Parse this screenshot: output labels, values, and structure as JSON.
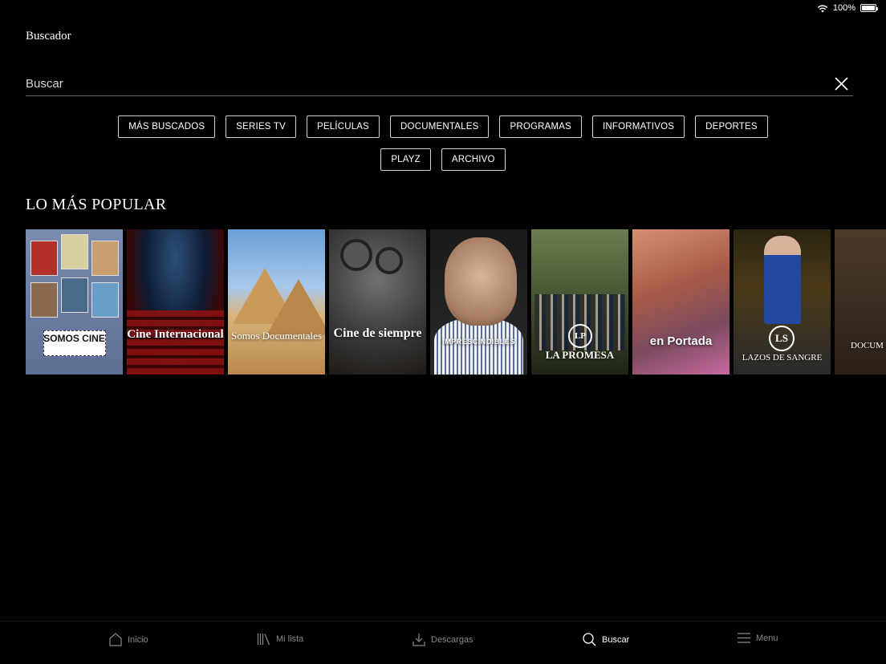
{
  "status": {
    "battery_label": "100%",
    "battery_level": 1.0
  },
  "page_title": "Buscador",
  "search": {
    "placeholder": "Buscar",
    "value": ""
  },
  "chips": [
    "MÁS BUSCADOS",
    "SERIES TV",
    "PELÍCULAS",
    "DOCUMENTALES",
    "PROGRAMAS",
    "INFORMATIVOS",
    "DEPORTES",
    "PLAYZ",
    "ARCHIVO"
  ],
  "section_title": "LO MÁS POPULAR",
  "cards": [
    {
      "title": "SOMOS CINE"
    },
    {
      "title": "Cine Internacional"
    },
    {
      "title": "Somos Documentales"
    },
    {
      "title": "Cine de siempre"
    },
    {
      "title": "IMPRESCINDIBLES"
    },
    {
      "title": "LA PROMESA"
    },
    {
      "title": "en Portada"
    },
    {
      "title": "LAZOS DE SANGRE"
    },
    {
      "title": "DOCUM"
    }
  ],
  "tabs": [
    {
      "label": "Inicio",
      "icon": "home-icon"
    },
    {
      "label": "Mi lista",
      "icon": "library-icon"
    },
    {
      "label": "Descargas",
      "icon": "download-icon"
    },
    {
      "label": "Buscar",
      "icon": "search-icon"
    },
    {
      "label": "Menu",
      "icon": "menu-icon"
    }
  ],
  "colors": {
    "background": "#000000",
    "text": "#ffffff",
    "inactive_tab": "#8a8a8a"
  }
}
